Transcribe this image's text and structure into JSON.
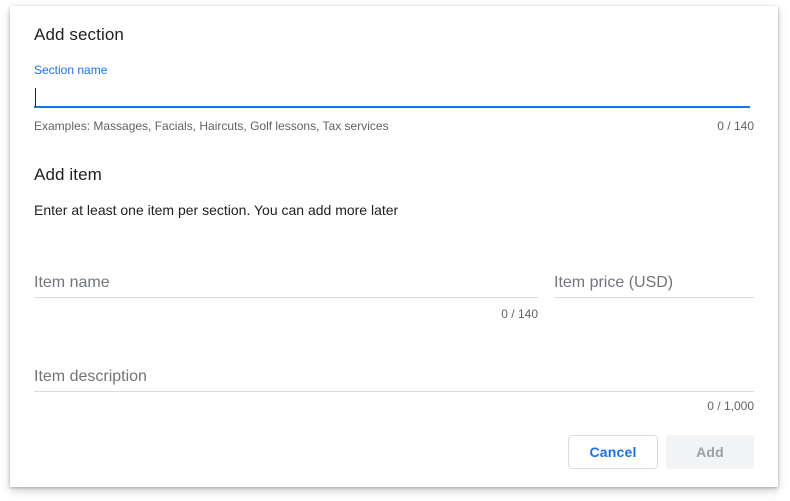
{
  "dialog": {
    "section": {
      "title": "Add section",
      "name_label": "Section name",
      "name_value": "",
      "helper": "Examples: Massages, Facials, Haircuts, Golf lessons, Tax services",
      "counter": "0 / 140"
    },
    "item": {
      "title": "Add item",
      "description": "Enter at least one item per section. You can add more later",
      "name_placeholder": "Item name",
      "name_counter": "0 / 140",
      "price_placeholder": "Item price (USD)",
      "description_placeholder": "Item description",
      "description_counter": "0 / 1,000"
    },
    "actions": {
      "cancel_label": "Cancel",
      "add_label": "Add"
    }
  },
  "colors": {
    "accent": "#1a73e8",
    "text": "#202124",
    "secondary_text": "#5f6368",
    "divider": "#dadce0",
    "disabled_bg": "#f1f3f4",
    "disabled_text": "#9aa0a6"
  }
}
